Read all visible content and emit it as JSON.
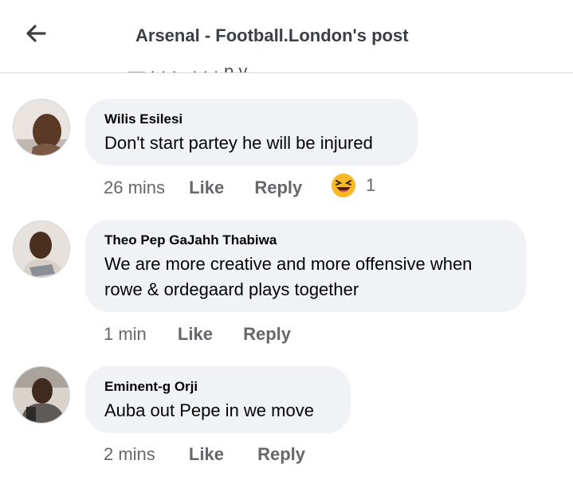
{
  "header": {
    "title": "Arsenal - Football.London's post",
    "back_icon": "arrow-left-icon"
  },
  "clipped_text": "— · · · , · · · p y",
  "comments": [
    {
      "author": "Wilis Esilesi",
      "text": "Don't start partey he will be injured",
      "time": "26 mins",
      "like_label": "Like",
      "reply_label": "Reply",
      "reaction": {
        "icon": "laughing-emoji-icon",
        "count": "1"
      }
    },
    {
      "author": "Theo Pep GaJahh Thabiwa",
      "text": "We are more creative and more offensive when rowe & ordegaard plays together",
      "time": "1 min",
      "like_label": "Like",
      "reply_label": "Reply"
    },
    {
      "author": "Eminent-g Orji",
      "text": "Auba out Pepe in we move",
      "time": "2 mins",
      "like_label": "Like",
      "reply_label": "Reply"
    }
  ],
  "colors": {
    "bubble": "#f0f2f5",
    "secondary_text": "#65676b",
    "header_title": "#3b3f45"
  }
}
